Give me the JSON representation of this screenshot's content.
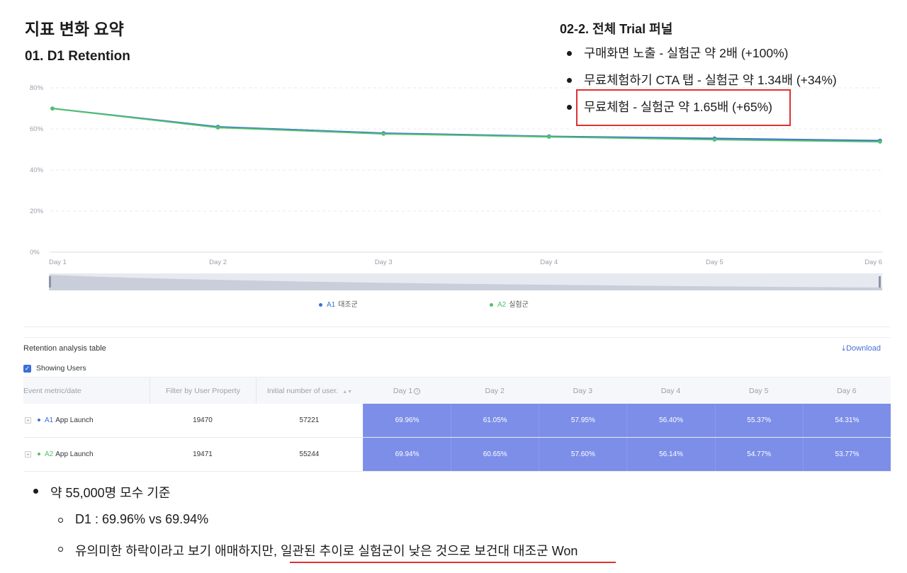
{
  "header": {
    "page_title": "지표 변화 요약",
    "section_title": "01. D1 Retention",
    "funnel_title": "02-2. 전체 Trial 퍼널"
  },
  "funnel": [
    "구매화면 노출 - 실험군 약 2배 (+100%)",
    "무료체험하기 CTA 탭 - 실험군 약 1.34배 (+34%)",
    "무료체험 - 실험군 약 1.65배 (+65%)"
  ],
  "chart_data": {
    "type": "line",
    "categories": [
      "Day 1",
      "Day 2",
      "Day 3",
      "Day 4",
      "Day 5",
      "Day 6"
    ],
    "y_ticks": [
      "80%",
      "60%",
      "40%",
      "20%",
      "0%"
    ],
    "ylim": [
      0,
      80
    ],
    "grid": true,
    "legend_position": "bottom",
    "series": [
      {
        "code": "A1",
        "name": "대조군",
        "color": "#3b6fd8",
        "values": [
          69.96,
          61.05,
          57.95,
          56.4,
          55.37,
          54.31
        ]
      },
      {
        "code": "A2",
        "name": "실험군",
        "color": "#52c06c",
        "values": [
          69.94,
          60.65,
          57.6,
          56.14,
          54.77,
          53.77
        ]
      }
    ]
  },
  "table": {
    "caption": "Retention analysis table",
    "download_label": "Download",
    "showing_users_label": "Showing Users",
    "columns": [
      "Event metric/date",
      "Filter by User Property",
      "Initial number of user.",
      "Day 1",
      "Day 2",
      "Day 3",
      "Day 4",
      "Day 5",
      "Day 6"
    ],
    "rows": [
      {
        "code": "A1",
        "event": "App Launch",
        "filter": "19470",
        "initial": "57221",
        "days": [
          "69.96%",
          "61.05%",
          "57.95%",
          "56.40%",
          "55.37%",
          "54.31%"
        ]
      },
      {
        "code": "A2",
        "event": "App Launch",
        "filter": "19471",
        "initial": "55244",
        "days": [
          "69.94%",
          "60.65%",
          "57.60%",
          "56.14%",
          "54.77%",
          "53.77%"
        ]
      }
    ]
  },
  "notes": {
    "item1": "약 55,000명 모수 기준",
    "sub1": "D1 : 69.96% vs 69.94%",
    "sub2": "유의미한 하락이라고 보기 애매하지만, 일관된 추이로 실험군이 낮은 것으로 보건대 대조군 Won"
  }
}
